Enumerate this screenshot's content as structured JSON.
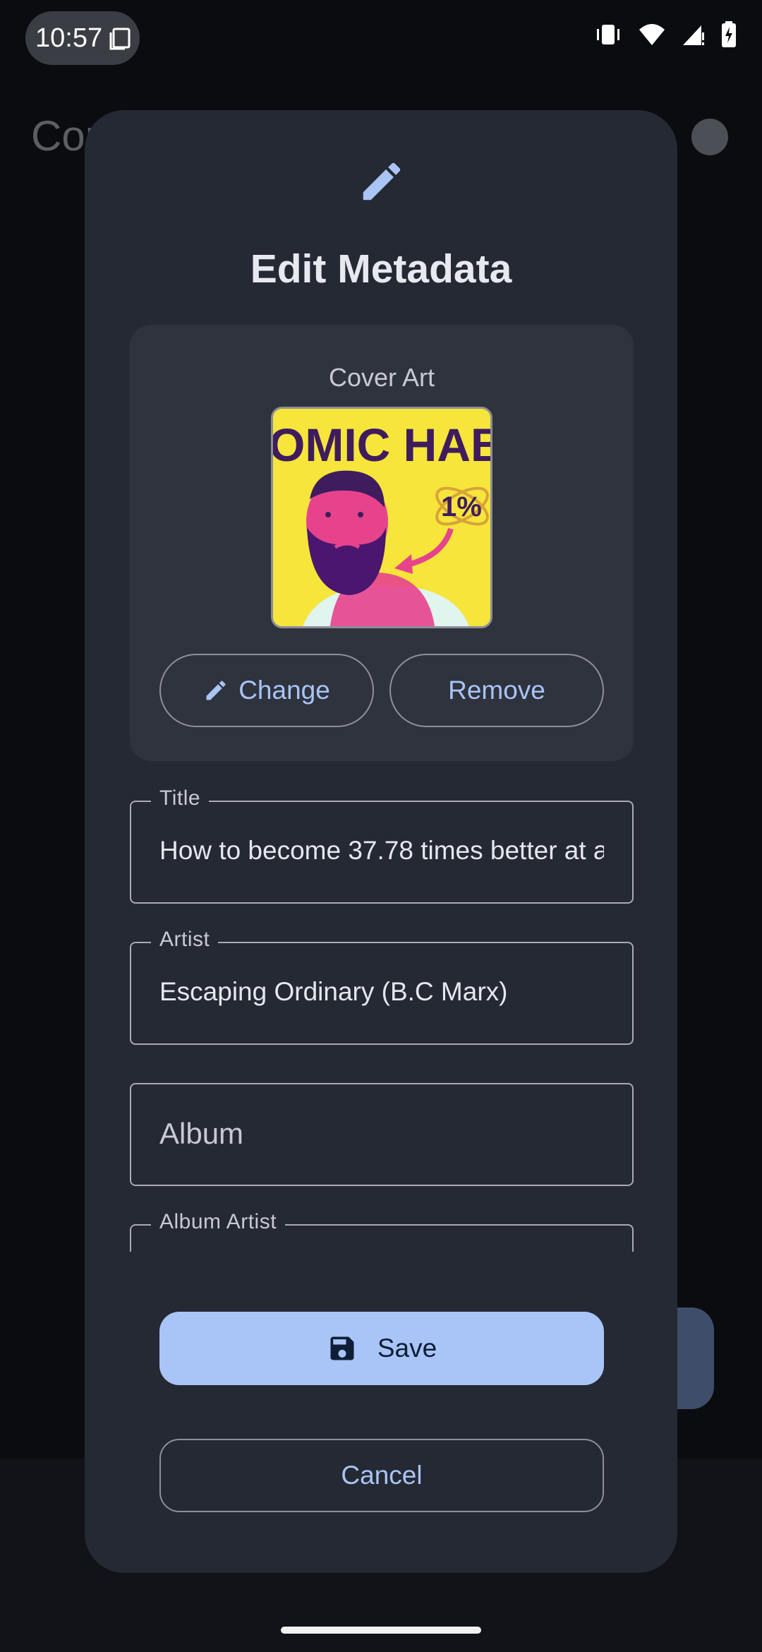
{
  "status_bar": {
    "time": "10:57"
  },
  "background": {
    "title": "Cor"
  },
  "dialog": {
    "title": "Edit Metadata",
    "icon": "pencil-icon",
    "cover": {
      "label": "Cover Art",
      "image_text": "OMIC HAB",
      "badge_text": "1%",
      "change_label": "Change",
      "remove_label": "Remove"
    },
    "fields": {
      "title": {
        "label": "Title",
        "value": "How to become 37.78 times better at a"
      },
      "artist": {
        "label": "Artist",
        "value": "Escaping Ordinary (B.C Marx)"
      },
      "album": {
        "placeholder": "Album"
      },
      "album_artist": {
        "label": "Album Artist"
      }
    },
    "save_label": "Save",
    "cancel_label": "Cancel"
  },
  "colors": {
    "dialog_bg": "#252933",
    "accent": "#a9c5f7",
    "card_bg": "#2f333e"
  }
}
